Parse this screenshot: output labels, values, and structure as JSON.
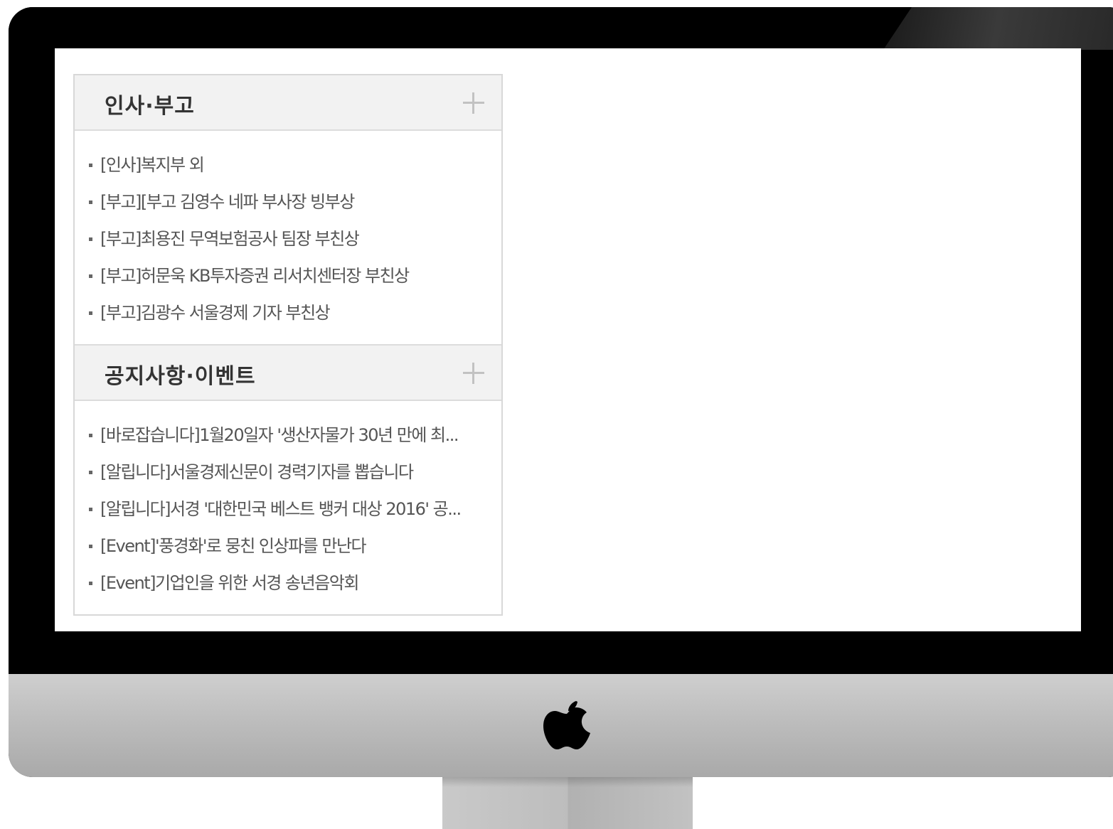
{
  "sections": [
    {
      "title": "인사·부고",
      "items": [
        "[인사]복지부 외",
        "[부고][부고 김영수 네파 부사장 빙부상",
        "[부고]최용진 무역보험공사 팀장 부친상",
        "[부고]허문욱 KB투자증권 리서치센터장 부친상",
        "[부고]김광수 서울경제 기자 부친상"
      ]
    },
    {
      "title": "공지사항·이벤트",
      "items": [
        "[바로잡습니다]1월20일자 '생산자물가 30년 만에 최...",
        "[알립니다]서울경제신문이 경력기자를 뽑습니다",
        "[알립니다]서경 '대한민국 베스트 뱅커 대상 2016' 공...",
        "[Event]'풍경화'로 뭉친 인상파를 만난다",
        "[Event]기업인을 위한 서경 송년음악회"
      ]
    }
  ],
  "icons": {
    "expand": "plus-icon",
    "logo": "apple-logo-icon"
  },
  "colors": {
    "header_bg": "#f2f2f2",
    "border": "#d8d8d8",
    "title_text": "#333333",
    "item_text": "#555555"
  }
}
